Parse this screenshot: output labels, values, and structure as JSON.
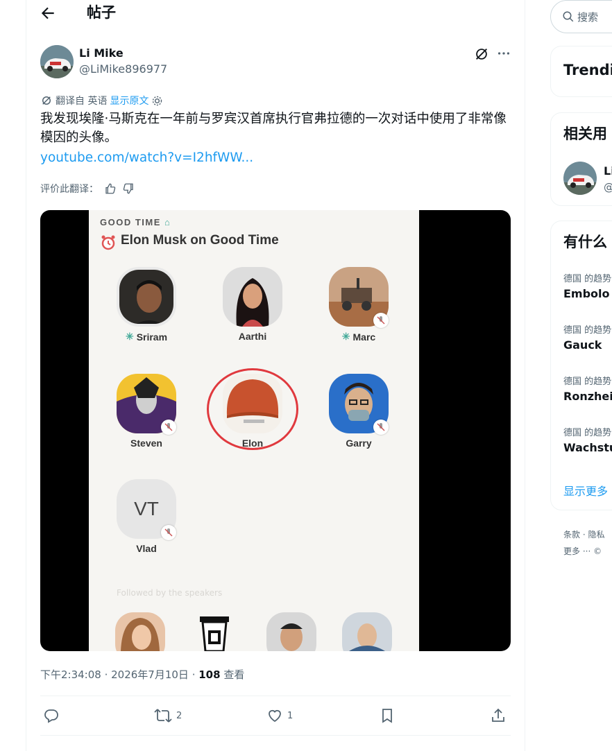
{
  "header": {
    "title": "帖子"
  },
  "tweet": {
    "author_name": "Li Mike",
    "author_handle": "@LiMike896977",
    "translated_from": "翻译自 英语",
    "show_original": "显示原文",
    "text": "我发现埃隆·马斯克在一年前与罗宾汉首席执行官弗拉德的一次对话中使用了非常像模因的头像。",
    "link": "youtube.com/watch?v=I2hfWW...",
    "rate_translation": "评价此翻译：",
    "timestamp": "下午2:34:08 · 2026年7月10日 · ",
    "views_count": "108",
    "views_label": " 查看",
    "retweets": "2",
    "likes": "1"
  },
  "media": {
    "room_label": "GOOD TIME",
    "room_title": "Elon Musk on Good Time",
    "vt_initials": "VT",
    "faint_text": "Followed by the speakers",
    "people": [
      {
        "name": "Sriram"
      },
      {
        "name": "Aarthi"
      },
      {
        "name": "Marc"
      },
      {
        "name": "Steven"
      },
      {
        "name": "Elon"
      },
      {
        "name": "Garry"
      },
      {
        "name": "Vlad"
      }
    ]
  },
  "sidebar": {
    "search_placeholder": "搜索",
    "trending_title": "Trendi",
    "related_title": "相关用",
    "related_user_name": "Li",
    "related_user_handle": "@",
    "whats_happening_title": "有什么",
    "trends": [
      {
        "context": "德国 的趋势",
        "name": "Embolo"
      },
      {
        "context": "德国 的趋势",
        "name": "Gauck"
      },
      {
        "context": "德国 的趋势",
        "name": "Ronzhei"
      },
      {
        "context": "德国 的趋势",
        "name": "Wachstu"
      }
    ],
    "show_more": "显示更多",
    "footer_line1": "条款 · 隐私",
    "footer_line2": "更多 ··· ©"
  },
  "colors": {
    "accent": "#1d9bf0",
    "secondary_text": "#536471",
    "primary_text": "#0f1419",
    "elon_circle": "#e0393e"
  }
}
